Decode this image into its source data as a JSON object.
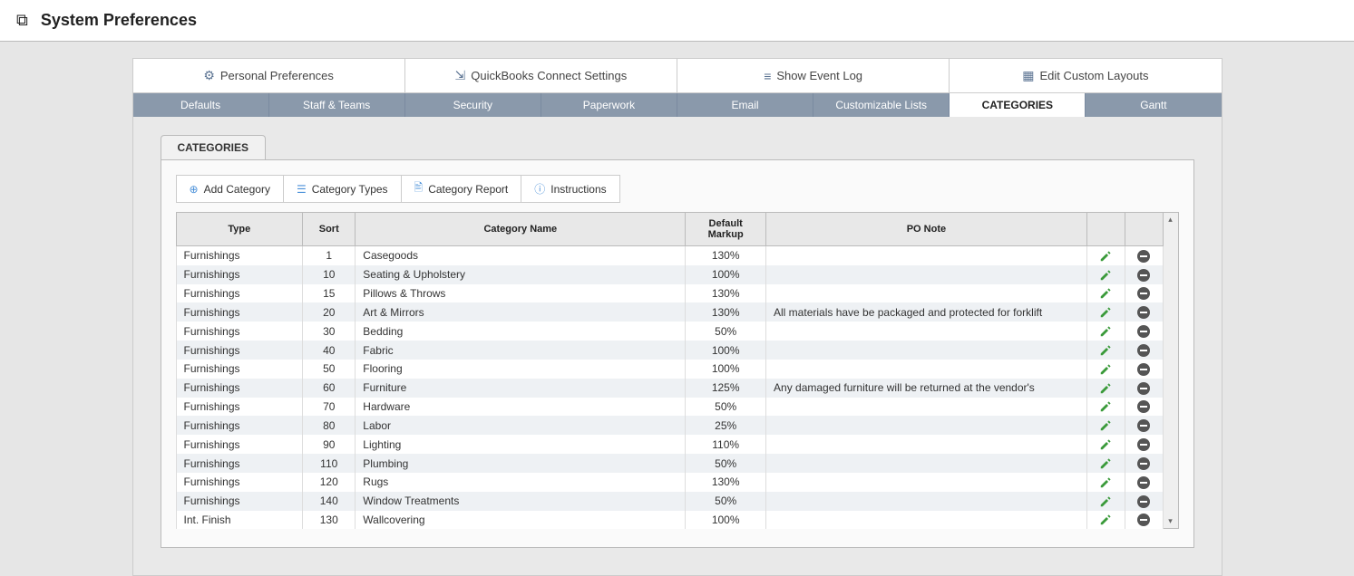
{
  "header": {
    "title": "System Preferences"
  },
  "actions": [
    {
      "icon": "gear-icon",
      "glyph": "⚙",
      "label": "Personal Preferences"
    },
    {
      "icon": "arrows-icon",
      "glyph": "⇲",
      "label": "QuickBooks Connect Settings"
    },
    {
      "icon": "list-icon",
      "glyph": "≡",
      "label": "Show Event Log"
    },
    {
      "icon": "layout-icon",
      "glyph": "▦",
      "label": "Edit Custom Layouts"
    }
  ],
  "tabs": [
    {
      "label": "Defaults",
      "active": false
    },
    {
      "label": "Staff & Teams",
      "active": false
    },
    {
      "label": "Security",
      "active": false
    },
    {
      "label": "Paperwork",
      "active": false
    },
    {
      "label": "Email",
      "active": false
    },
    {
      "label": "Customizable Lists",
      "active": false
    },
    {
      "label": "CATEGORIES",
      "active": true
    },
    {
      "label": "Gantt",
      "active": false
    }
  ],
  "subtab": {
    "label": "CATEGORIES"
  },
  "toolbar": [
    {
      "icon": "plus-icon",
      "glyph": "⊕",
      "label": "Add Category"
    },
    {
      "icon": "types-icon",
      "glyph": "☰",
      "label": "Category Types"
    },
    {
      "icon": "report-icon",
      "glyph": "🖹",
      "label": "Category Report"
    },
    {
      "icon": "info-icon",
      "glyph": "ⓘ",
      "label": "Instructions"
    }
  ],
  "columns": {
    "type": "Type",
    "sort": "Sort",
    "name": "Category Name",
    "markup": "Default Markup",
    "note": "PO Note"
  },
  "rows": [
    {
      "type": "Furnishings",
      "sort": "1",
      "name": "Casegoods",
      "markup": "130%",
      "note": ""
    },
    {
      "type": "Furnishings",
      "sort": "10",
      "name": "Seating & Upholstery",
      "markup": "100%",
      "note": ""
    },
    {
      "type": "Furnishings",
      "sort": "15",
      "name": "Pillows & Throws",
      "markup": "130%",
      "note": ""
    },
    {
      "type": "Furnishings",
      "sort": "20",
      "name": "Art & Mirrors",
      "markup": "130%",
      "note": "All materials have be packaged and protected for forklift"
    },
    {
      "type": "Furnishings",
      "sort": "30",
      "name": "Bedding",
      "markup": "50%",
      "note": ""
    },
    {
      "type": "Furnishings",
      "sort": "40",
      "name": "Fabric",
      "markup": "100%",
      "note": ""
    },
    {
      "type": "Furnishings",
      "sort": "50",
      "name": "Flooring",
      "markup": "100%",
      "note": ""
    },
    {
      "type": "Furnishings",
      "sort": "60",
      "name": "Furniture",
      "markup": "125%",
      "note": "Any damaged furniture will be returned at the vendor's"
    },
    {
      "type": "Furnishings",
      "sort": "70",
      "name": "Hardware",
      "markup": "50%",
      "note": ""
    },
    {
      "type": "Furnishings",
      "sort": "80",
      "name": "Labor",
      "markup": "25%",
      "note": ""
    },
    {
      "type": "Furnishings",
      "sort": "90",
      "name": "Lighting",
      "markup": "110%",
      "note": ""
    },
    {
      "type": "Furnishings",
      "sort": "110",
      "name": "Plumbing",
      "markup": "50%",
      "note": ""
    },
    {
      "type": "Furnishings",
      "sort": "120",
      "name": "Rugs",
      "markup": "130%",
      "note": ""
    },
    {
      "type": "Furnishings",
      "sort": "140",
      "name": "Window Treatments",
      "markup": "50%",
      "note": ""
    },
    {
      "type": "Int. Finish",
      "sort": "130",
      "name": "Wallcovering",
      "markup": "100%",
      "note": ""
    }
  ]
}
